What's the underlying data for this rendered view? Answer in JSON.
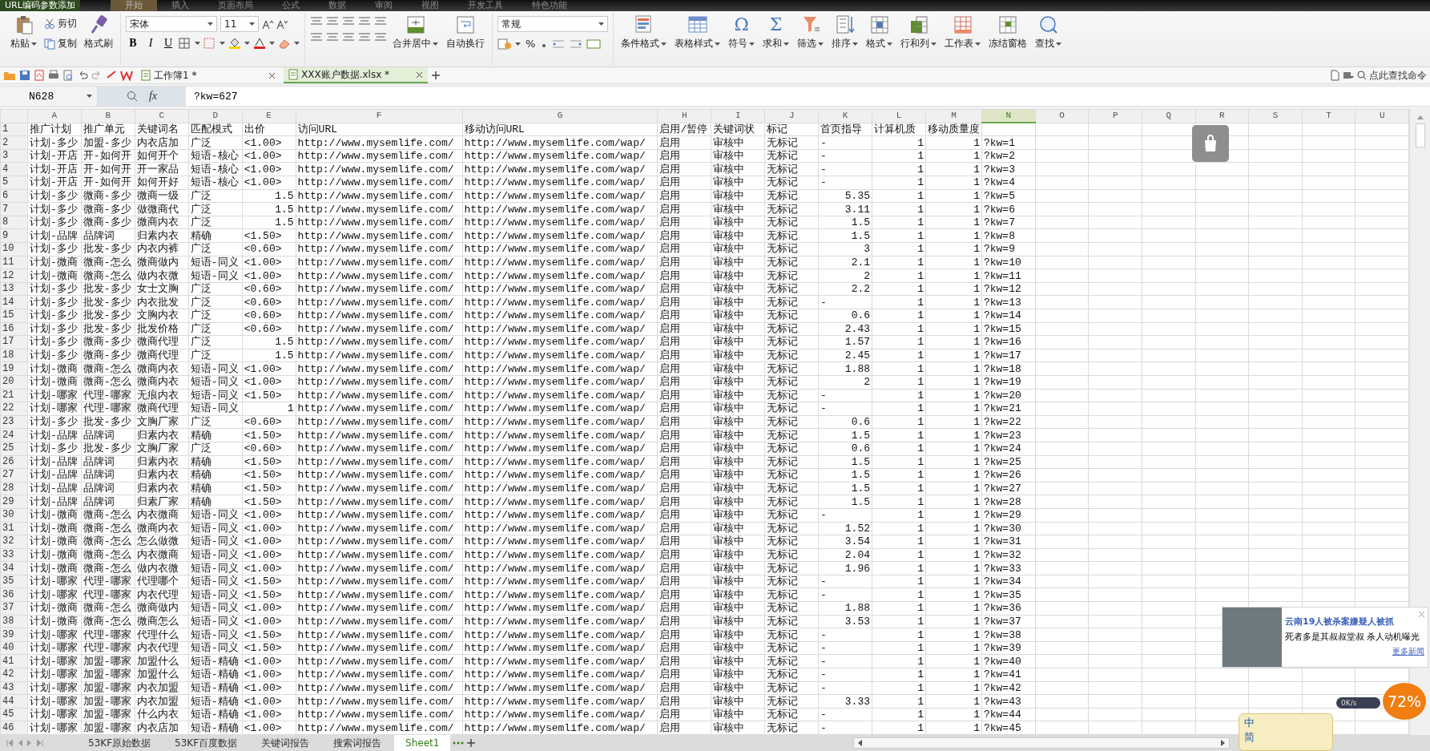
{
  "window": {
    "title": "URL编码参数添加"
  },
  "menu_tabs": [
    {
      "label": "开始",
      "selected": true
    },
    {
      "label": "插入",
      "selected": false
    },
    {
      "label": "页面布局",
      "selected": false
    },
    {
      "label": "公式",
      "selected": false
    },
    {
      "label": "数据",
      "selected": false
    },
    {
      "label": "审阅",
      "selected": false
    },
    {
      "label": "视图",
      "selected": false
    },
    {
      "label": "开发工具",
      "selected": false
    },
    {
      "label": "特色功能",
      "selected": false
    }
  ],
  "ribbon": {
    "clipboard": {
      "paste": "粘贴",
      "cut": "剪切",
      "copy": "复制",
      "format_painter": "格式刷"
    },
    "font": {
      "name": "宋体",
      "size": "11",
      "styles": [
        "B",
        "I",
        "U"
      ]
    },
    "merge": "合并居中",
    "wrap": "自动换行",
    "number_format": "常规",
    "percent": "%",
    "tools": [
      {
        "label": "条件格式",
        "dropdown": true
      },
      {
        "label": "表格样式",
        "dropdown": true
      },
      {
        "label": "符号",
        "glyph": "Ω",
        "dropdown": true
      },
      {
        "label": "求和",
        "glyph": "Σ",
        "dropdown": true
      },
      {
        "label": "筛选",
        "dropdown": true
      },
      {
        "label": "排序",
        "dropdown": true
      },
      {
        "label": "格式",
        "dropdown": true
      },
      {
        "label": "行和列",
        "dropdown": true
      },
      {
        "label": "工作表",
        "dropdown": true
      },
      {
        "label": "冻结窗格",
        "dropdown": false
      },
      {
        "label": "查找",
        "dropdown": true
      }
    ]
  },
  "document_tabs": [
    {
      "label": "工作簿1 *",
      "selected": false
    },
    {
      "label": "XXX账户数据.xlsx *",
      "selected": true
    }
  ],
  "command_search": {
    "placeholder": "点此查找命令"
  },
  "formula_bar": {
    "cell": "N628",
    "fx": "fx",
    "value": "?kw=627"
  },
  "sheet": {
    "columns": [
      {
        "letter": "A",
        "selected": false
      },
      {
        "letter": "B",
        "selected": false
      },
      {
        "letter": "C",
        "selected": false
      },
      {
        "letter": "D",
        "selected": false
      },
      {
        "letter": "E",
        "selected": false
      },
      {
        "letter": "F",
        "selected": false
      },
      {
        "letter": "G",
        "selected": false
      },
      {
        "letter": "H",
        "selected": false
      },
      {
        "letter": "I",
        "selected": false
      },
      {
        "letter": "J",
        "selected": false
      },
      {
        "letter": "K",
        "selected": false
      },
      {
        "letter": "L",
        "selected": false
      },
      {
        "letter": "M",
        "selected": false
      },
      {
        "letter": "N",
        "selected": true
      },
      {
        "letter": "O",
        "selected": false
      },
      {
        "letter": "P",
        "selected": false
      },
      {
        "letter": "Q",
        "selected": false
      },
      {
        "letter": "R",
        "selected": false
      },
      {
        "letter": "S",
        "selected": false
      },
      {
        "letter": "T",
        "selected": false
      },
      {
        "letter": "U",
        "selected": false
      }
    ],
    "rows": [
      {
        "number": "1",
        "cells": [
          "推广计划",
          "推广单元",
          "关键词名",
          "匹配模式",
          "出价",
          "访问URL",
          "移动访问URL",
          "启用/暂停",
          "关键词状",
          "标记",
          "首页指导",
          "计算机质",
          "移动质量度"
        ]
      },
      {
        "number": "2",
        "cells": [
          "计划-多少",
          "加盟-多少",
          "内衣店加",
          "广泛",
          "<1.00>",
          "http://www.mysemlife.com/",
          "http://www.mysemlife.com/wap/",
          "启用",
          "审核中",
          "无标记",
          "-",
          {
            "number": "1"
          },
          {
            "number": "1"
          },
          "?kw=1"
        ]
      },
      {
        "number": "3",
        "cells": [
          "计划-开店",
          "开-如何开",
          "如何开个",
          "短语-核心",
          "<1.00>",
          "http://www.mysemlife.com/",
          "http://www.mysemlife.com/wap/",
          "启用",
          "审核中",
          "无标记",
          "-",
          {
            "number": "1"
          },
          {
            "number": "1"
          },
          "?kw=2"
        ]
      },
      {
        "number": "4",
        "cells": [
          "计划-开店",
          "开-如何开",
          "开一家品",
          "短语-核心",
          "<1.00>",
          "http://www.mysemlife.com/",
          "http://www.mysemlife.com/wap/",
          "启用",
          "审核中",
          "无标记",
          "-",
          {
            "number": "1"
          },
          {
            "number": "1"
          },
          "?kw=3"
        ]
      },
      {
        "number": "5",
        "cells": [
          "计划-开店",
          "开-如何开",
          "如何开好",
          "短语-核心",
          "<1.00>",
          "http://www.mysemlife.com/",
          "http://www.mysemlife.com/wap/",
          "启用",
          "审核中",
          "无标记",
          "-",
          {
            "number": "1"
          },
          {
            "number": "1"
          },
          "?kw=4"
        ]
      },
      {
        "number": "6",
        "cells": [
          "计划-多少",
          "微商-多少",
          "微商一级",
          "广泛",
          {
            "number": "1.5"
          },
          "http://www.mysemlife.com/",
          "http://www.mysemlife.com/wap/",
          "启用",
          "审核中",
          "无标记",
          {
            "number": "5.35"
          },
          {
            "number": "1"
          },
          {
            "number": "1"
          },
          "?kw=5"
        ]
      },
      {
        "number": "7",
        "cells": [
          "计划-多少",
          "微商-多少",
          "做微商代",
          "广泛",
          {
            "number": "1.5"
          },
          "http://www.mysemlife.com/",
          "http://www.mysemlife.com/wap/",
          "启用",
          "审核中",
          "无标记",
          {
            "number": "3.11"
          },
          {
            "number": "1"
          },
          {
            "number": "1"
          },
          "?kw=6"
        ]
      },
      {
        "number": "8",
        "cells": [
          "计划-多少",
          "微商-多少",
          "微商内衣",
          "广泛",
          {
            "number": "1.5"
          },
          "http://www.mysemlife.com/",
          "http://www.mysemlife.com/wap/",
          "启用",
          "审核中",
          "无标记",
          {
            "number": "1.5"
          },
          {
            "number": "1"
          },
          {
            "number": "1"
          },
          "?kw=7"
        ]
      },
      {
        "number": "9",
        "cells": [
          "计划-品牌",
          "品牌词",
          "归素内衣",
          "精确",
          "<1.50>",
          "http://www.mysemlife.com/",
          "http://www.mysemlife.com/wap/",
          "启用",
          "审核中",
          "无标记",
          {
            "number": "1.5"
          },
          {
            "number": "1"
          },
          {
            "number": "1"
          },
          "?kw=8"
        ]
      },
      {
        "number": "10",
        "cells": [
          "计划-多少",
          "批发-多少",
          "内衣内裤",
          "广泛",
          "<0.60>",
          "http://www.mysemlife.com/",
          "http://www.mysemlife.com/wap/",
          "启用",
          "审核中",
          "无标记",
          {
            "number": "3"
          },
          {
            "number": "1"
          },
          {
            "number": "1"
          },
          "?kw=9"
        ]
      },
      {
        "number": "11",
        "cells": [
          "计划-微商",
          "微商-怎么",
          "微商做内",
          "短语-同义",
          "<1.00>",
          "http://www.mysemlife.com/",
          "http://www.mysemlife.com/wap/",
          "启用",
          "审核中",
          "无标记",
          {
            "number": "2.1"
          },
          {
            "number": "1"
          },
          {
            "number": "1"
          },
          "?kw=10"
        ]
      },
      {
        "number": "12",
        "cells": [
          "计划-微商",
          "微商-怎么",
          "做内衣微",
          "短语-同义",
          "<1.00>",
          "http://www.mysemlife.com/",
          "http://www.mysemlife.com/wap/",
          "启用",
          "审核中",
          "无标记",
          {
            "number": "2"
          },
          {
            "number": "1"
          },
          {
            "number": "1"
          },
          "?kw=11"
        ]
      },
      {
        "number": "13",
        "cells": [
          "计划-多少",
          "批发-多少",
          "女士文胸",
          "广泛",
          "<0.60>",
          "http://www.mysemlife.com/",
          "http://www.mysemlife.com/wap/",
          "启用",
          "审核中",
          "无标记",
          {
            "number": "2.2"
          },
          {
            "number": "1"
          },
          {
            "number": "1"
          },
          "?kw=12"
        ]
      },
      {
        "number": "14",
        "cells": [
          "计划-多少",
          "批发-多少",
          "内衣批发",
          "广泛",
          "<0.60>",
          "http://www.mysemlife.com/",
          "http://www.mysemlife.com/wap/",
          "启用",
          "审核中",
          "无标记",
          "-",
          {
            "number": "1"
          },
          {
            "number": "1"
          },
          "?kw=13"
        ]
      },
      {
        "number": "15",
        "cells": [
          "计划-多少",
          "批发-多少",
          "文胸内衣",
          "广泛",
          "<0.60>",
          "http://www.mysemlife.com/",
          "http://www.mysemlife.com/wap/",
          "启用",
          "审核中",
          "无标记",
          {
            "number": "0.6"
          },
          {
            "number": "1"
          },
          {
            "number": "1"
          },
          "?kw=14"
        ]
      },
      {
        "number": "16",
        "cells": [
          "计划-多少",
          "批发-多少",
          "批发价格",
          "广泛",
          "<0.60>",
          "http://www.mysemlife.com/",
          "http://www.mysemlife.com/wap/",
          "启用",
          "审核中",
          "无标记",
          {
            "number": "2.43"
          },
          {
            "number": "1"
          },
          {
            "number": "1"
          },
          "?kw=15"
        ]
      },
      {
        "number": "17",
        "cells": [
          "计划-多少",
          "微商-多少",
          "微商代理",
          "广泛",
          {
            "number": "1.5"
          },
          "http://www.mysemlife.com/",
          "http://www.mysemlife.com/wap/",
          "启用",
          "审核中",
          "无标记",
          {
            "number": "1.57"
          },
          {
            "number": "1"
          },
          {
            "number": "1"
          },
          "?kw=16"
        ]
      },
      {
        "number": "18",
        "cells": [
          "计划-多少",
          "微商-多少",
          "微商代理",
          "广泛",
          {
            "number": "1.5"
          },
          "http://www.mysemlife.com/",
          "http://www.mysemlife.com/wap/",
          "启用",
          "审核中",
          "无标记",
          {
            "number": "2.45"
          },
          {
            "number": "1"
          },
          {
            "number": "1"
          },
          "?kw=17"
        ]
      },
      {
        "number": "19",
        "cells": [
          "计划-微商",
          "微商-怎么",
          "微商内衣",
          "短语-同义",
          "<1.00>",
          "http://www.mysemlife.com/",
          "http://www.mysemlife.com/wap/",
          "启用",
          "审核中",
          "无标记",
          {
            "number": "1.88"
          },
          {
            "number": "1"
          },
          {
            "number": "1"
          },
          "?kw=18"
        ]
      },
      {
        "number": "20",
        "cells": [
          "计划-微商",
          "微商-怎么",
          "微商内衣",
          "短语-同义",
          "<1.00>",
          "http://www.mysemlife.com/",
          "http://www.mysemlife.com/wap/",
          "启用",
          "审核中",
          "无标记",
          {
            "number": "2"
          },
          {
            "number": "1"
          },
          {
            "number": "1"
          },
          "?kw=19"
        ]
      },
      {
        "number": "21",
        "cells": [
          "计划-哪家",
          "代理-哪家",
          "无痕内衣",
          "短语-同义",
          "<1.50>",
          "http://www.mysemlife.com/",
          "http://www.mysemlife.com/wap/",
          "启用",
          "审核中",
          "无标记",
          "-",
          {
            "number": "1"
          },
          {
            "number": "1"
          },
          "?kw=20"
        ]
      },
      {
        "number": "22",
        "cells": [
          "计划-哪家",
          "代理-哪家",
          "微商代理",
          "短语-同义",
          {
            "number": "1"
          },
          "http://www.mysemlife.com/",
          "http://www.mysemlife.com/wap/",
          "启用",
          "审核中",
          "无标记",
          "-",
          {
            "number": "1"
          },
          {
            "number": "1"
          },
          "?kw=21"
        ]
      },
      {
        "number": "23",
        "cells": [
          "计划-多少",
          "批发-多少",
          "文胸厂家",
          "广泛",
          "<0.60>",
          "http://www.mysemlife.com/",
          "http://www.mysemlife.com/wap/",
          "启用",
          "审核中",
          "无标记",
          {
            "number": "0.6"
          },
          {
            "number": "1"
          },
          {
            "number": "1"
          },
          "?kw=22"
        ]
      },
      {
        "number": "24",
        "cells": [
          "计划-品牌",
          "品牌词",
          "归素内衣",
          "精确",
          "<1.50>",
          "http://www.mysemlife.com/",
          "http://www.mysemlife.com/wap/",
          "启用",
          "审核中",
          "无标记",
          {
            "number": "1.5"
          },
          {
            "number": "1"
          },
          {
            "number": "1"
          },
          "?kw=23"
        ]
      },
      {
        "number": "25",
        "cells": [
          "计划-多少",
          "批发-多少",
          "文胸厂家",
          "广泛",
          "<0.60>",
          "http://www.mysemlife.com/",
          "http://www.mysemlife.com/wap/",
          "启用",
          "审核中",
          "无标记",
          {
            "number": "0.6"
          },
          {
            "number": "1"
          },
          {
            "number": "1"
          },
          "?kw=24"
        ]
      },
      {
        "number": "26",
        "cells": [
          "计划-品牌",
          "品牌词",
          "归素内衣",
          "精确",
          "<1.50>",
          "http://www.mysemlife.com/",
          "http://www.mysemlife.com/wap/",
          "启用",
          "审核中",
          "无标记",
          {
            "number": "1.5"
          },
          {
            "number": "1"
          },
          {
            "number": "1"
          },
          "?kw=25"
        ]
      },
      {
        "number": "27",
        "cells": [
          "计划-品牌",
          "品牌词",
          "归素内衣",
          "精确",
          "<1.50>",
          "http://www.mysemlife.com/",
          "http://www.mysemlife.com/wap/",
          "启用",
          "审核中",
          "无标记",
          {
            "number": "1.5"
          },
          {
            "number": "1"
          },
          {
            "number": "1"
          },
          "?kw=26"
        ]
      },
      {
        "number": "28",
        "cells": [
          "计划-品牌",
          "品牌词",
          "归素内衣",
          "精确",
          "<1.50>",
          "http://www.mysemlife.com/",
          "http://www.mysemlife.com/wap/",
          "启用",
          "审核中",
          "无标记",
          {
            "number": "1.5"
          },
          {
            "number": "1"
          },
          {
            "number": "1"
          },
          "?kw=27"
        ]
      },
      {
        "number": "29",
        "cells": [
          "计划-品牌",
          "品牌词",
          "归素厂家",
          "精确",
          "<1.50>",
          "http://www.mysemlife.com/",
          "http://www.mysemlife.com/wap/",
          "启用",
          "审核中",
          "无标记",
          {
            "number": "1.5"
          },
          {
            "number": "1"
          },
          {
            "number": "1"
          },
          "?kw=28"
        ]
      },
      {
        "number": "30",
        "cells": [
          "计划-微商",
          "微商-怎么",
          "内衣微商",
          "短语-同义",
          "<1.00>",
          "http://www.mysemlife.com/",
          "http://www.mysemlife.com/wap/",
          "启用",
          "审核中",
          "无标记",
          "-",
          {
            "number": "1"
          },
          {
            "number": "1"
          },
          "?kw=29"
        ]
      },
      {
        "number": "31",
        "cells": [
          "计划-微商",
          "微商-怎么",
          "微商内衣",
          "短语-同义",
          "<1.00>",
          "http://www.mysemlife.com/",
          "http://www.mysemlife.com/wap/",
          "启用",
          "审核中",
          "无标记",
          {
            "number": "1.52"
          },
          {
            "number": "1"
          },
          {
            "number": "1"
          },
          "?kw=30"
        ]
      },
      {
        "number": "32",
        "cells": [
          "计划-微商",
          "微商-怎么",
          "怎么做微",
          "短语-同义",
          "<1.00>",
          "http://www.mysemlife.com/",
          "http://www.mysemlife.com/wap/",
          "启用",
          "审核中",
          "无标记",
          {
            "number": "3.54"
          },
          {
            "number": "1"
          },
          {
            "number": "1"
          },
          "?kw=31"
        ]
      },
      {
        "number": "33",
        "cells": [
          "计划-微商",
          "微商-怎么",
          "内衣微商",
          "短语-同义",
          "<1.00>",
          "http://www.mysemlife.com/",
          "http://www.mysemlife.com/wap/",
          "启用",
          "审核中",
          "无标记",
          {
            "number": "2.04"
          },
          {
            "number": "1"
          },
          {
            "number": "1"
          },
          "?kw=32"
        ]
      },
      {
        "number": "34",
        "cells": [
          "计划-微商",
          "微商-怎么",
          "做内衣微",
          "短语-同义",
          "<1.00>",
          "http://www.mysemlife.com/",
          "http://www.mysemlife.com/wap/",
          "启用",
          "审核中",
          "无标记",
          {
            "number": "1.96"
          },
          {
            "number": "1"
          },
          {
            "number": "1"
          },
          "?kw=33"
        ]
      },
      {
        "number": "35",
        "cells": [
          "计划-哪家",
          "代理-哪家",
          "代理哪个",
          "短语-同义",
          "<1.50>",
          "http://www.mysemlife.com/",
          "http://www.mysemlife.com/wap/",
          "启用",
          "审核中",
          "无标记",
          "-",
          {
            "number": "1"
          },
          {
            "number": "1"
          },
          "?kw=34"
        ]
      },
      {
        "number": "36",
        "cells": [
          "计划-哪家",
          "代理-哪家",
          "内衣代理",
          "短语-同义",
          "<1.50>",
          "http://www.mysemlife.com/",
          "http://www.mysemlife.com/wap/",
          "启用",
          "审核中",
          "无标记",
          "-",
          {
            "number": "1"
          },
          {
            "number": "1"
          },
          "?kw=35"
        ]
      },
      {
        "number": "37",
        "cells": [
          "计划-微商",
          "微商-怎么",
          "微商做内",
          "短语-同义",
          "<1.00>",
          "http://www.mysemlife.com/",
          "http://www.mysemlife.com/wap/",
          "启用",
          "审核中",
          "无标记",
          {
            "number": "1.88"
          },
          {
            "number": "1"
          },
          {
            "number": "1"
          },
          "?kw=36"
        ]
      },
      {
        "number": "38",
        "cells": [
          "计划-微商",
          "微商-怎么",
          "微商怎么",
          "短语-同义",
          "<1.00>",
          "http://www.mysemlife.com/",
          "http://www.mysemlife.com/wap/",
          "启用",
          "审核中",
          "无标记",
          {
            "number": "3.53"
          },
          {
            "number": "1"
          },
          {
            "number": "1"
          },
          "?kw=37"
        ]
      },
      {
        "number": "39",
        "cells": [
          "计划-哪家",
          "代理-哪家",
          "代理什么",
          "短语-同义",
          "<1.50>",
          "http://www.mysemlife.com/",
          "http://www.mysemlife.com/wap/",
          "启用",
          "审核中",
          "无标记",
          "-",
          {
            "number": "1"
          },
          {
            "number": "1"
          },
          "?kw=38"
        ]
      },
      {
        "number": "40",
        "cells": [
          "计划-哪家",
          "代理-哪家",
          "内衣代理",
          "短语-同义",
          "<1.50>",
          "http://www.mysemlife.com/",
          "http://www.mysemlife.com/wap/",
          "启用",
          "审核中",
          "无标记",
          "-",
          {
            "number": "1"
          },
          {
            "number": "1"
          },
          "?kw=39"
        ]
      },
      {
        "number": "41",
        "cells": [
          "计划-哪家",
          "加盟-哪家",
          "加盟什么",
          "短语-精确",
          "<1.00>",
          "http://www.mysemlife.com/",
          "http://www.mysemlife.com/wap/",
          "启用",
          "审核中",
          "无标记",
          "-",
          {
            "number": "1"
          },
          {
            "number": "1"
          },
          "?kw=40"
        ]
      },
      {
        "number": "42",
        "cells": [
          "计划-哪家",
          "加盟-哪家",
          "加盟什么",
          "短语-精确",
          "<1.00>",
          "http://www.mysemlife.com/",
          "http://www.mysemlife.com/wap/",
          "启用",
          "审核中",
          "无标记",
          "-",
          {
            "number": "1"
          },
          {
            "number": "1"
          },
          "?kw=41"
        ]
      },
      {
        "number": "43",
        "cells": [
          "计划-哪家",
          "加盟-哪家",
          "内衣加盟",
          "短语-精确",
          "<1.00>",
          "http://www.mysemlife.com/",
          "http://www.mysemlife.com/wap/",
          "启用",
          "审核中",
          "无标记",
          "-",
          {
            "number": "1"
          },
          {
            "number": "1"
          },
          "?kw=42"
        ]
      },
      {
        "number": "44",
        "cells": [
          "计划-哪家",
          "加盟-哪家",
          "内衣加盟",
          "短语-精确",
          "<1.00>",
          "http://www.mysemlife.com/",
          "http://www.mysemlife.com/wap/",
          "启用",
          "审核中",
          "无标记",
          {
            "number": "3.33"
          },
          {
            "number": "1"
          },
          {
            "number": "1"
          },
          "?kw=43"
        ]
      },
      {
        "number": "45",
        "cells": [
          "计划-哪家",
          "加盟-哪家",
          "什么内衣",
          "短语-精确",
          "<1.00>",
          "http://www.mysemlife.com/",
          "http://www.mysemlife.com/wap/",
          "启用",
          "审核中",
          "无标记",
          "-",
          {
            "number": "1"
          },
          {
            "number": "1"
          },
          "?kw=44"
        ]
      },
      {
        "number": "46",
        "cells": [
          "计划-哪家",
          "加盟-哪家",
          "内衣店加",
          "短语-精确",
          "<1.00>",
          "http://www.mysemlife.com/",
          "http://www.mysemlife.com/wap/",
          "启用",
          "审核中",
          "无标记",
          "-",
          {
            "number": "1"
          },
          {
            "number": "1"
          },
          "?kw=45"
        ]
      }
    ]
  },
  "sheet_tabs": [
    {
      "label": "53KF原始数据",
      "selected": false
    },
    {
      "label": "53KF百度数据",
      "selected": false
    },
    {
      "label": "关键词报告",
      "selected": false
    },
    {
      "label": "搜索词报告",
      "selected": false
    },
    {
      "label": "Sheet1",
      "selected": true
    }
  ],
  "news_popup": {
    "headline": "云南19人被杀案嫌疑人被抓",
    "summary": "死者多是其叔叔堂叔 杀人动机曝光",
    "link": "更多新闻"
  },
  "speed_widget": {
    "percent": "72%",
    "rate": "0K/s"
  },
  "ime_bar": {
    "language": "中",
    "script": "简"
  }
}
